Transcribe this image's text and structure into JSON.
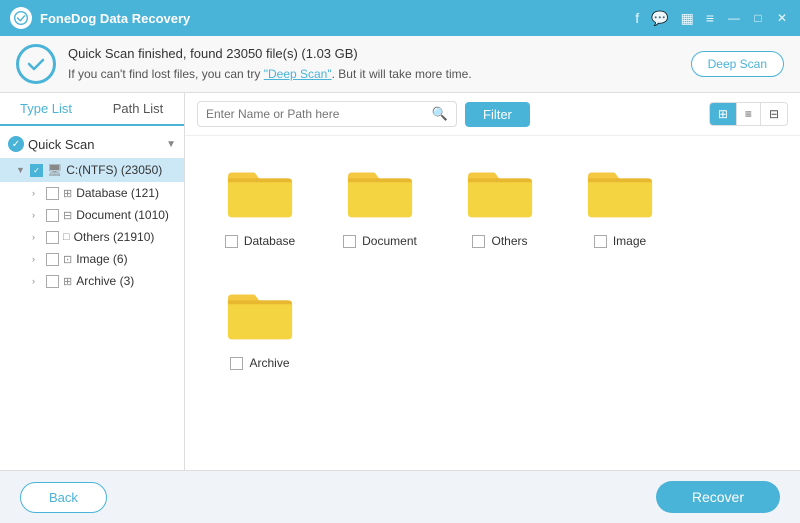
{
  "titleBar": {
    "logo": "fonedog-logo",
    "title": "FoneDog Data Recovery",
    "icons": [
      "facebook-icon",
      "message-icon",
      "qr-icon",
      "menu-icon"
    ],
    "controls": [
      "minimize-icon",
      "maximize-icon",
      "close-icon"
    ]
  },
  "notification": {
    "status": "Quick Scan finished, found 23050 file(s) (1.03 GB)",
    "hint_prefix": "If you can't find lost files, you can try ",
    "deep_scan_link": "\"Deep Scan\"",
    "hint_suffix": ". But it will take more time.",
    "deep_scan_button": "Deep Scan"
  },
  "sidebar": {
    "tab1": "Type List",
    "tab2": "Path List",
    "quick_scan_label": "Quick Scan",
    "tree": [
      {
        "label": "C:(NTFS) (23050)",
        "expanded": true,
        "selected": true,
        "children": [
          {
            "label": "Database (121)",
            "icon": "database"
          },
          {
            "label": "Document (1010)",
            "icon": "document"
          },
          {
            "label": "Others (21910)",
            "icon": "folder"
          },
          {
            "label": "Image (6)",
            "icon": "image"
          },
          {
            "label": "Archive (3)",
            "icon": "archive"
          }
        ]
      }
    ]
  },
  "toolbar": {
    "search_placeholder": "Enter Name or Path here",
    "filter_label": "Filter",
    "view_grid_icon": "grid-view-icon",
    "view_list_icon": "list-view-icon",
    "view_detail_icon": "detail-view-icon"
  },
  "files": [
    {
      "name": "Database",
      "type": "folder"
    },
    {
      "name": "Document",
      "type": "folder"
    },
    {
      "name": "Others",
      "type": "folder"
    },
    {
      "name": "Image",
      "type": "folder"
    },
    {
      "name": "Archive",
      "type": "folder"
    }
  ],
  "bottom": {
    "back_label": "Back",
    "recover_label": "Recover"
  }
}
